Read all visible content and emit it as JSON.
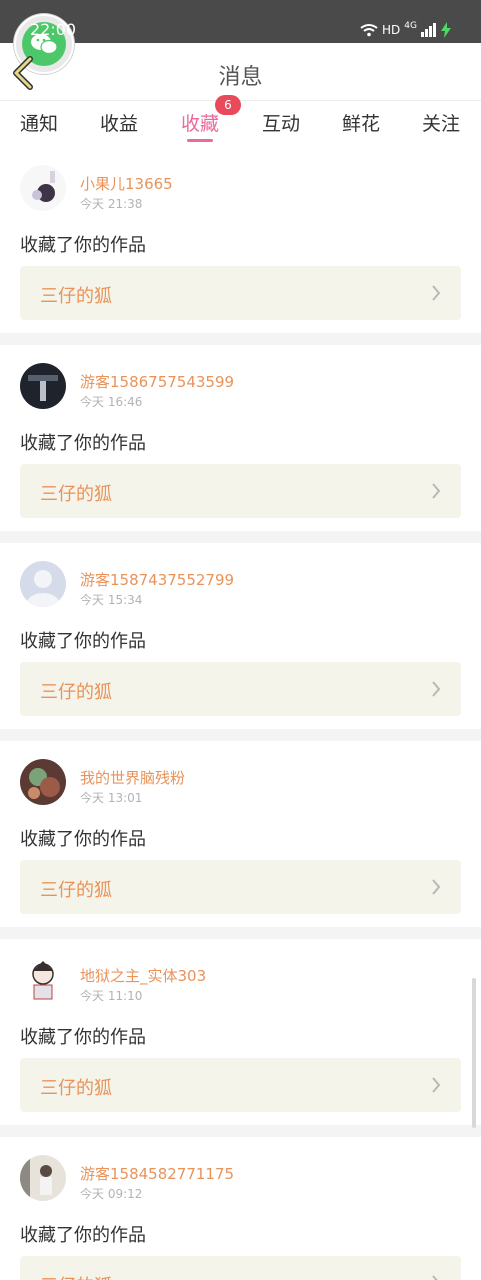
{
  "status_bar": {
    "time": "22:00",
    "hd": "HD",
    "network": "4G"
  },
  "header": {
    "title": "消息"
  },
  "tabs": [
    {
      "label": "通知"
    },
    {
      "label": "收益"
    },
    {
      "label": "收藏",
      "active": true,
      "badge": "6"
    },
    {
      "label": "互动"
    },
    {
      "label": "鲜花"
    },
    {
      "label": "关注"
    }
  ],
  "items": [
    {
      "user": "小果儿13665",
      "time": "今天 21:38",
      "action": "收藏了你的作品",
      "work": "三仔的狐",
      "avatar": "anime-avatar"
    },
    {
      "user": "游客1586757543599",
      "time": "今天 16:46",
      "action": "收藏了你的作品",
      "work": "三仔的狐",
      "avatar": "dark-photo-avatar"
    },
    {
      "user": "游客1587437552799",
      "time": "今天 15:34",
      "action": "收藏了你的作品",
      "work": "三仔的狐",
      "avatar": "default-avatar"
    },
    {
      "user": "我的世界脑残粉",
      "time": "今天 13:01",
      "action": "收藏了你的作品",
      "work": "三仔的狐",
      "avatar": "game-avatar"
    },
    {
      "user": "地狱之主_实体303",
      "time": "今天 11:10",
      "action": "收藏了你的作品",
      "work": "三仔的狐",
      "avatar": "character-avatar"
    },
    {
      "user": "游客1584582771175",
      "time": "今天 09:12",
      "action": "收藏了你的作品",
      "work": "三仔的狐",
      "avatar": "photo-avatar"
    }
  ],
  "colors": {
    "accent": "#e96a9c",
    "username": "#e9935a",
    "badge": "#e84a5a",
    "work_bg": "#f4f4ea"
  }
}
